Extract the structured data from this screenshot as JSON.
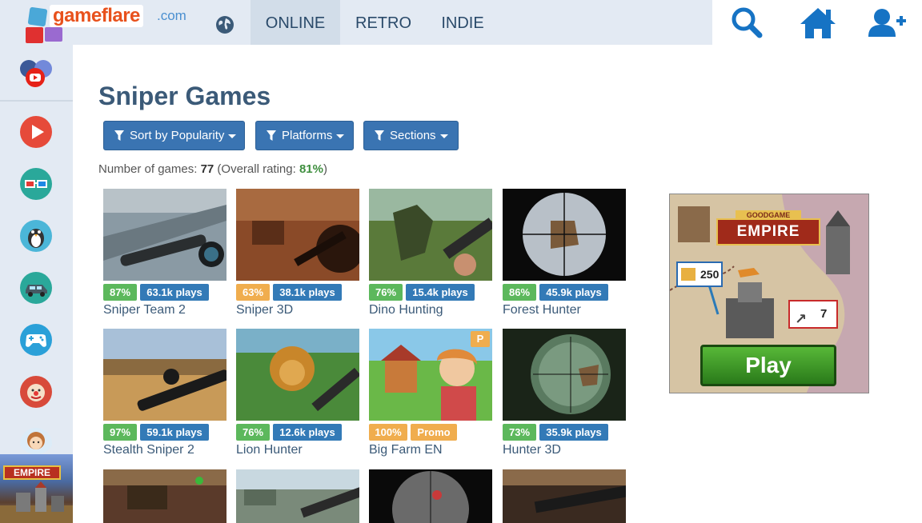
{
  "header": {
    "logo_text": "gameflare",
    "logo_domain": ".com",
    "tabs": [
      {
        "label": "ONLINE",
        "active": true
      },
      {
        "label": "RETRO",
        "active": false
      },
      {
        "label": "INDIE",
        "active": false
      }
    ],
    "icons": [
      "globe-icon",
      "search-icon",
      "home-icon",
      "add-user-icon"
    ]
  },
  "sidebar": {
    "icons": [
      "social-links-icon",
      "video-play-icon",
      "3d-glasses-icon",
      "penguin-icon",
      "car-icon",
      "gamepad-icon",
      "clown-icon",
      "girl-icon"
    ],
    "ad_banner_text": "EMPIRE"
  },
  "main": {
    "title": "Sniper Games",
    "filters": [
      {
        "label": "Sort by Popularity"
      },
      {
        "label": "Platforms"
      },
      {
        "label": "Sections"
      }
    ],
    "count_label": "Number of games:",
    "count_value": "77",
    "rating_prefix": "(Overall rating:",
    "rating_value": "81%",
    "rating_suffix": ")"
  },
  "games": [
    {
      "title": "Sniper Team 2",
      "rating": "87%",
      "plays": "63.1k plays",
      "rating_color": "green"
    },
    {
      "title": "Sniper 3D",
      "rating": "63%",
      "plays": "38.1k plays",
      "rating_color": "orange"
    },
    {
      "title": "Dino Hunting",
      "rating": "76%",
      "plays": "15.4k plays",
      "rating_color": "green"
    },
    {
      "title": "Forest Hunter",
      "rating": "86%",
      "plays": "45.9k plays",
      "rating_color": "green"
    },
    {
      "title": "Stealth Sniper 2",
      "rating": "97%",
      "plays": "59.1k plays",
      "rating_color": "green"
    },
    {
      "title": "Lion Hunter",
      "rating": "76%",
      "plays": "12.6k plays",
      "rating_color": "green"
    },
    {
      "title": "Big Farm EN",
      "rating": "100%",
      "plays": "Promo",
      "rating_color": "orange",
      "promo": true,
      "corner_badge": "P"
    },
    {
      "title": "Hunter 3D",
      "rating": "73%",
      "plays": "35.9k plays",
      "rating_color": "green"
    }
  ],
  "ad": {
    "brand": "GOODGAME",
    "title": "EMPIRE",
    "resource_value": "250",
    "arrow_value": "7",
    "button_label": "Play"
  }
}
